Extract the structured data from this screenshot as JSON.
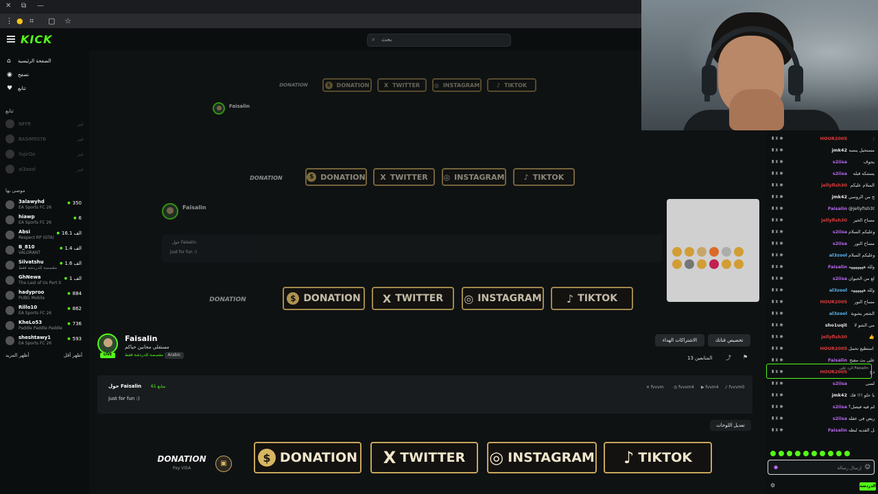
{
  "window": {
    "controls": [
      "✕",
      "⧉",
      "—"
    ]
  },
  "browser": {
    "icons": [
      "menu-dots-icon",
      "extension-icon",
      "crop-icon",
      "tab-icon",
      "star-icon"
    ]
  },
  "kick": {
    "logo": "KICK",
    "search_placeholder": "بحث"
  },
  "sidebar": {
    "nav": [
      {
        "label": "الصفحة الرئيسية",
        "icon": "⌂"
      },
      {
        "label": "تصفح",
        "icon": "◉"
      },
      {
        "label": "تتابع",
        "icon": "♥"
      }
    ],
    "following_title": "تتابع",
    "following": [
      {
        "name": "NFFR",
        "status": "غير"
      },
      {
        "name": "BASIM5076",
        "status": "غير"
      },
      {
        "name": "YujirOo",
        "status": "غير"
      },
      {
        "name": "al3zool",
        "status": "غير"
      }
    ],
    "recommended_title": "موصى بها",
    "recommended": [
      {
        "name": "3alawyhd",
        "game": "EA Sports FC 26",
        "viewers": "350"
      },
      {
        "name": "hiawp",
        "game": "EA Sports FC 26",
        "viewers": "6"
      },
      {
        "name": "Absi",
        "game": "Respect RP (GTA)",
        "viewers": "16.1 الف"
      },
      {
        "name": "B_810",
        "game": "VALORANT",
        "viewers": "1.4 الف"
      },
      {
        "name": "Silvatshu",
        "game": "مقصصة للدردشة فقط",
        "viewers": "1.6 الف"
      },
      {
        "name": "GhNewa",
        "game": "The Last of Us Part II",
        "viewers": "1 الف"
      },
      {
        "name": "hadyproo",
        "game": "PUBG Mobile",
        "viewers": "884"
      },
      {
        "name": "Rillo10",
        "game": "EA Sports FC 26",
        "viewers": "862"
      },
      {
        "name": "KheLo53",
        "game": "Paddle Paddle Paddle",
        "viewers": "736"
      },
      {
        "name": "sheshtawy1",
        "game": "EA Sports FC 26",
        "viewers": "593"
      }
    ],
    "show_more_left": "أظهر المزيد",
    "show_more_right": "أظهر أقل"
  },
  "channel": {
    "name": "Faisalin",
    "live": "LIVE",
    "title": "مستقلي مجانين حياكم",
    "category": "مقصصة للدردشة فقط",
    "language": "Arabic",
    "subscribe_label": "الاشتراكات الهداء",
    "customize_label": "تخصيص قناتك",
    "followers": "13 المتابعين",
    "about_title": "حول Faisalin",
    "about_followers": "61 متابع",
    "about_text": "just for fun :)",
    "socials": [
      "fvvvm",
      "fvvvm4",
      "fvvm4",
      "fvvvm0"
    ],
    "edit_panels": "تعديل اللوحات"
  },
  "panels": {
    "donation_text": "DONATION",
    "donation_sub": "Pay  VISA",
    "buttons": [
      {
        "label": "DONATION",
        "icon": "$",
        "icon_name": "dollar-coin-icon"
      },
      {
        "label": "TWITTER",
        "icon": "X",
        "icon_name": "x-logo-icon"
      },
      {
        "label": "INSTAGRAM",
        "icon": "◎",
        "icon_name": "instagram-icon"
      },
      {
        "label": "TIKTOK",
        "icon": "♪",
        "icon_name": "tiktok-icon"
      }
    ]
  },
  "chat": {
    "messages": [
      {
        "user": "HOUR2005",
        "color": "#e03b3b",
        "msg": ":"
      },
      {
        "user": "jmk42",
        "color": "#e6e6e6",
        "msg": "مستحيل ينسه"
      },
      {
        "user": "s2iisa",
        "color": "#b96af0",
        "msg": "يحوف"
      },
      {
        "user": "s2iisa",
        "color": "#b96af0",
        "msg": "يستنكه قبله"
      },
      {
        "user": "jellyfish30",
        "color": "#e03b3b",
        "msg": "السلام عليكم"
      },
      {
        "user": "jmk42",
        "color": "#e6e6e6",
        "msg": "انوعح من الروسي"
      },
      {
        "user": "Faisalin",
        "color": "#b96af0",
        "msg": "@jellyfish30 حيث برمح"
      },
      {
        "user": "jellyfish30",
        "color": "#e03b3b",
        "msg": "مساح الخير"
      },
      {
        "user": "s2iisa",
        "color": "#b96af0",
        "msg": "وعليكم السلام"
      },
      {
        "user": "s2iisa",
        "color": "#b96af0",
        "msg": "مساح النور"
      },
      {
        "user": "al3zool",
        "color": "#5bb5f0",
        "msg": "وعليكم السلام"
      },
      {
        "user": "Faisalin",
        "color": "#b96af0",
        "msg": "ولله هههههههه"
      },
      {
        "user": "s2iisa",
        "color": "#b96af0",
        "msg": "طالع من الحيوان"
      },
      {
        "user": "al3zool",
        "color": "#5bb5f0",
        "msg": "ولله ههههههه"
      },
      {
        "user": "HOUR2005",
        "color": "#e03b3b",
        "msg": "مساح النور"
      },
      {
        "user": "al3zool",
        "color": "#5bb5f0",
        "msg": "الشعر يشوية"
      },
      {
        "user": "sho1uqit",
        "color": "#e6e6e6",
        "msg": "مي الشو لا"
      },
      {
        "user": "jellyfish30",
        "color": "#e03b3b",
        "msg": "👍"
      },
      {
        "user": "HOUR2005",
        "color": "#e03b3b",
        "msg": "لا استطيع تحمل"
      },
      {
        "user": "Faisalin",
        "color": "#b96af0",
        "msg": "على بث مفتح"
      },
      {
        "user": "HOUR2005",
        "color": "#e03b3b",
        "msg": "دح"
      },
      {
        "user": "s2iisa",
        "color": "#b96af0",
        "msg": "لسى"
      },
      {
        "user": "jmk42",
        "color": "#e6e6e6",
        "msg": "يا حلو !!! فك"
      },
      {
        "user": "s2iisa",
        "color": "#b96af0",
        "msg": "كم فيه فيصل؟"
      },
      {
        "user": "s2iisa",
        "color": "#b96af0",
        "msg": "مريض في عقله"
      },
      {
        "user": "Faisalin",
        "color": "#b96af0",
        "msg": "مشغل القديه لبطه"
      }
    ],
    "reply_hint": "الرد على Faisalin",
    "input_placeholder": "إرسال رسالة",
    "send_label": "الدردشة"
  },
  "colors": {
    "kick_green": "#53fc18",
    "gold": "#c9a85c",
    "bg": "#0f1213"
  }
}
